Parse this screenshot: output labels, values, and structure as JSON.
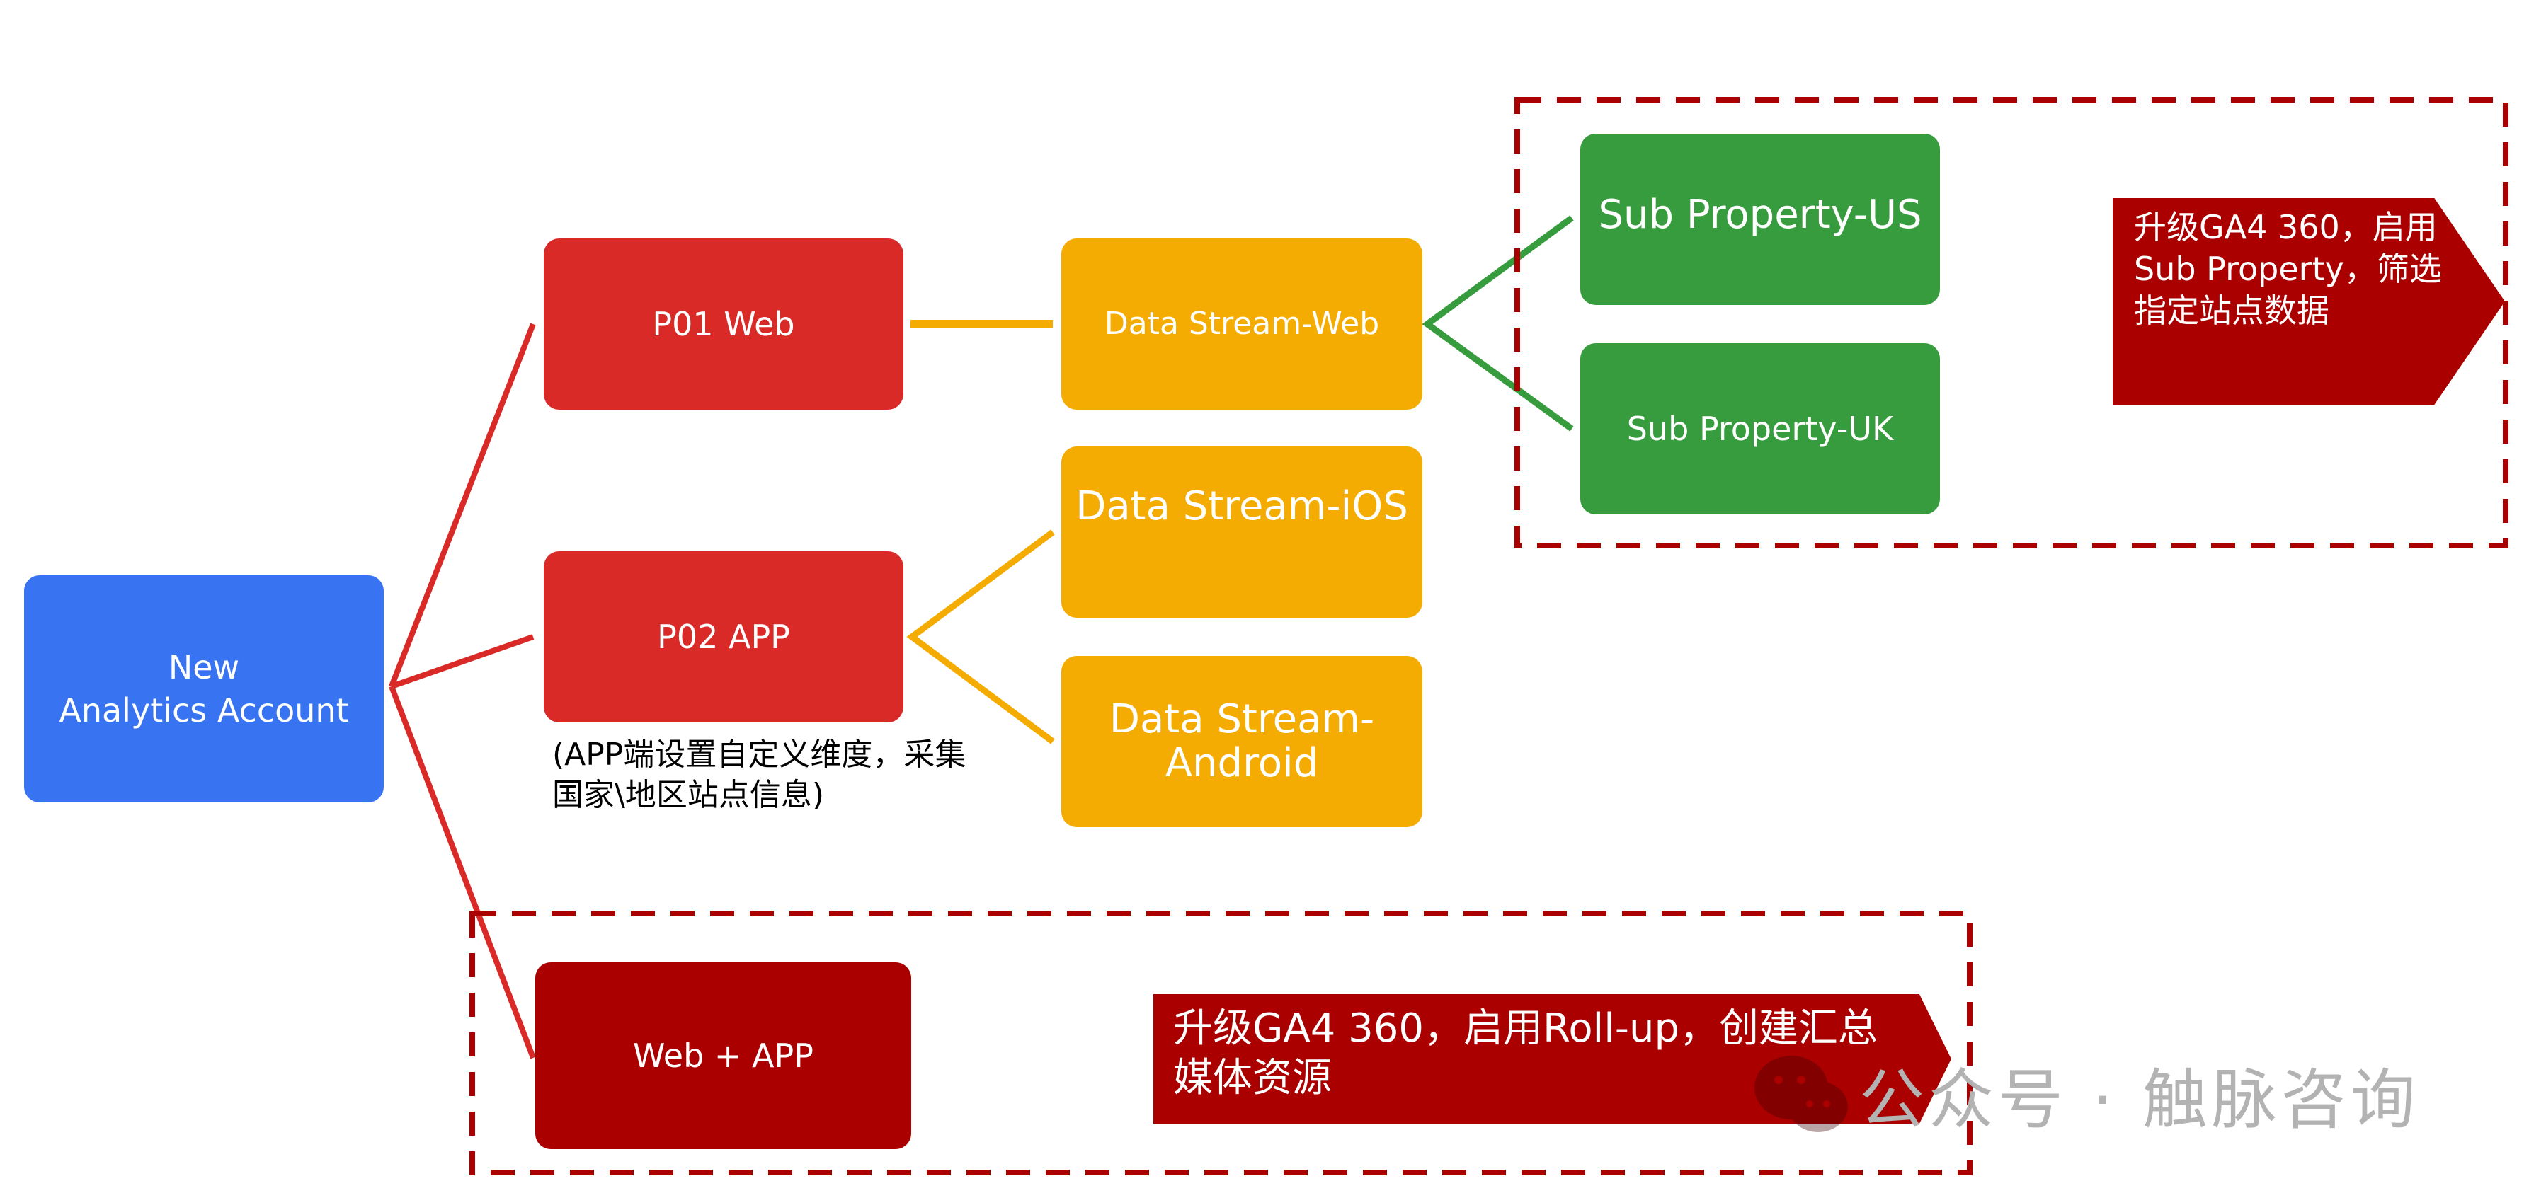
{
  "diagram": {
    "colors": {
      "account": "#3873F2",
      "property": "#D92A28",
      "rollup": "#AA0000",
      "stream": "#F5AC02",
      "subproperty": "#379C3D",
      "callout": "#AA0000"
    },
    "account": {
      "line1": "New",
      "line2": "Analytics Account"
    },
    "properties": [
      {
        "label": "P01 Web"
      },
      {
        "label": "P02 APP"
      }
    ],
    "p02_note": {
      "line1": "(APP端设置自定义维度，采集",
      "line2": "国家\\地区站点信息)"
    },
    "streams": [
      {
        "label": "Data Stream-Web"
      },
      {
        "label": "Data Stream-iOS"
      },
      {
        "line1": "Data Stream-",
        "line2": "Android"
      }
    ],
    "sub_properties": [
      {
        "label": "Sub Property-US"
      },
      {
        "label": "Sub Property-UK"
      }
    ],
    "callout_sub": {
      "line1": "升级GA4 360，启用",
      "line2": "Sub Property，筛选",
      "line3": "指定站点数据"
    },
    "rollup": {
      "label": "Web + APP"
    },
    "callout_rollup": {
      "line1": "升级GA4 360，启用Roll-up，创建汇总",
      "line2": "媒体资源"
    },
    "watermark": {
      "text": "公众号 · 触脉咨询",
      "icon": "wechat-icon"
    }
  }
}
